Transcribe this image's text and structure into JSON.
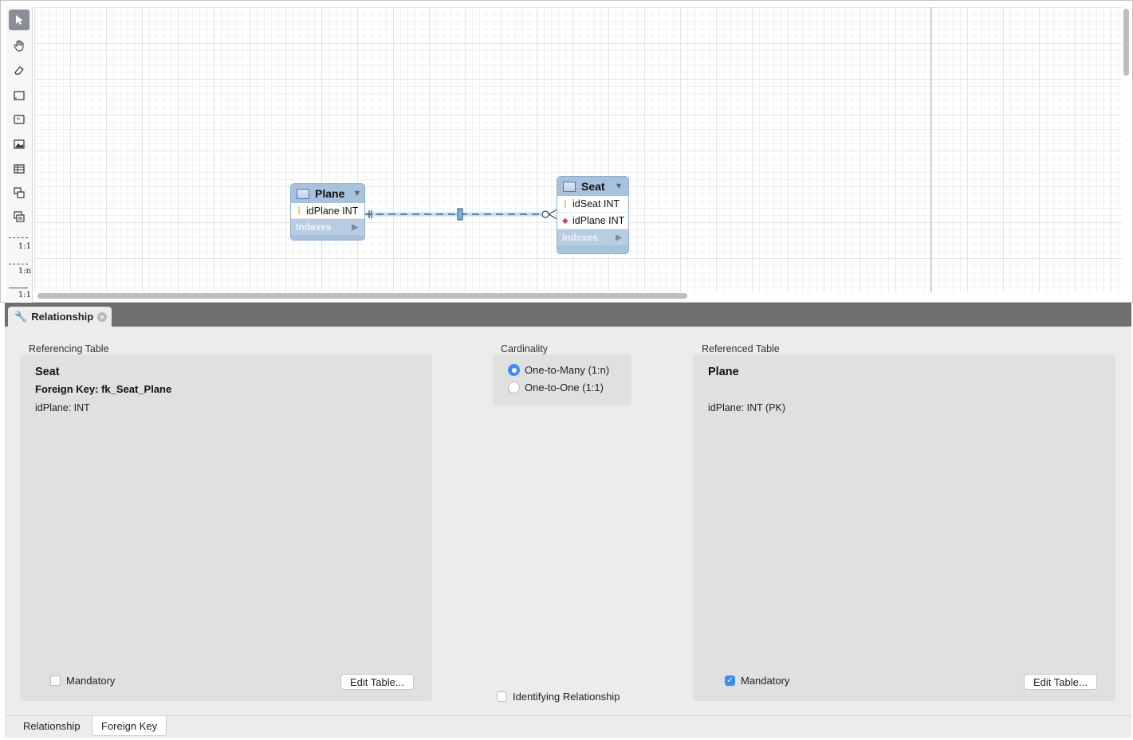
{
  "toolbar": {
    "tools": [
      "pointer-icon",
      "hand-icon",
      "eraser-icon",
      "layer-icon",
      "note-icon",
      "image-icon",
      "table-icon",
      "view-icon",
      "routine-group-icon"
    ],
    "relationship_labels": [
      "1:1",
      "1:n",
      "1:1"
    ]
  },
  "diagram": {
    "plane_table": {
      "name": "Plane",
      "columns": [
        {
          "key": "pk",
          "text": "idPlane INT"
        }
      ],
      "indexes_label": "Indexes"
    },
    "seat_table": {
      "name": "Seat",
      "columns": [
        {
          "key": "pk",
          "text": "idSeat INT"
        },
        {
          "key": "fk",
          "text": "idPlane INT"
        }
      ],
      "indexes_label": "Indexes"
    }
  },
  "panel": {
    "tab_label": "Relationship",
    "referencing": {
      "section_label": "Referencing Table",
      "table_name": "Seat",
      "foreign_key": "Foreign Key: fk_Seat_Plane",
      "column": "idPlane: INT",
      "mandatory_label": "Mandatory",
      "mandatory_checked": false,
      "edit_button": "Edit Table..."
    },
    "cardinality": {
      "section_label": "Cardinality",
      "options": [
        {
          "label": "One-to-Many (1:n)",
          "selected": true
        },
        {
          "label": "One-to-One (1:1)",
          "selected": false
        }
      ],
      "identifying_label": "Identifying Relationship",
      "identifying_checked": false
    },
    "referenced": {
      "section_label": "Referenced Table",
      "table_name": "Plane",
      "column": "idPlane: INT (PK)",
      "mandatory_label": "Mandatory",
      "mandatory_checked": true,
      "edit_button": "Edit Table..."
    }
  },
  "bottom_tabs": [
    {
      "label": "Relationship",
      "active": false
    },
    {
      "label": "Foreign Key",
      "active": true
    }
  ],
  "colors": {
    "table_header": "#a7c2dc",
    "accent": "#3b8ff0",
    "panel_bg": "#ececec",
    "tabbar_bg": "#6f6f6f"
  }
}
